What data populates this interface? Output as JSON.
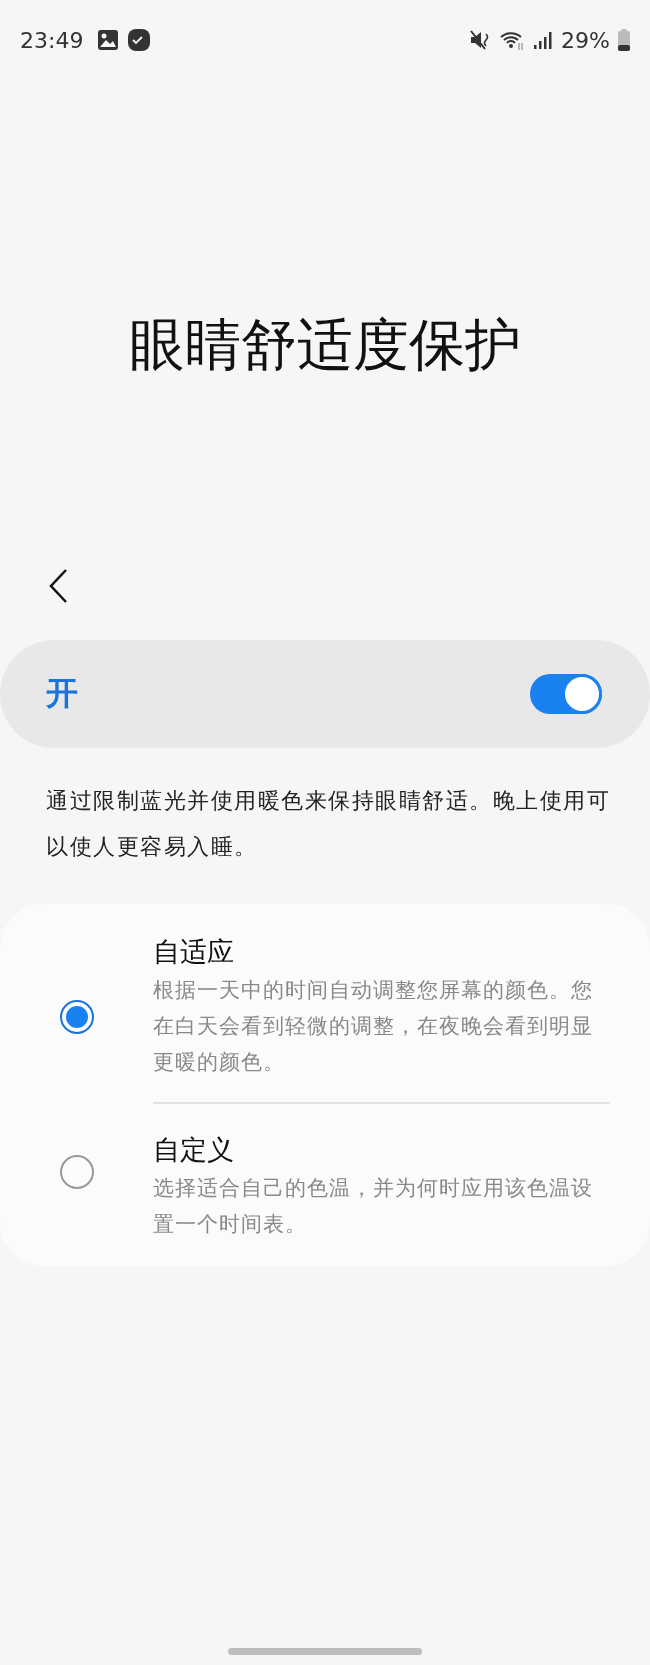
{
  "status_bar": {
    "time": "23:49",
    "battery": "29%"
  },
  "title": "眼睛舒适度保护",
  "master_switch": {
    "label": "开",
    "on": true
  },
  "description": "通过限制蓝光并使用暖色来保持眼睛舒适。晚上使用可以使人更容易入睡。",
  "modes": [
    {
      "title": "自适应",
      "description": "根据一天中的时间自动调整您屏幕的颜色。您在白天会看到轻微的调整，在夜晚会看到明显更暖的颜色。",
      "selected": true
    },
    {
      "title": "自定义",
      "description": "选择适合自己的色温，并为何时应用该色温设置一个时间表。",
      "selected": false
    }
  ]
}
